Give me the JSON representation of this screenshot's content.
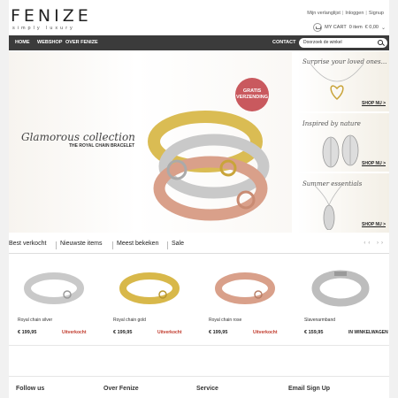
{
  "brand": {
    "name": "FENIZE",
    "tagline": "simply luxury"
  },
  "toplinks": [
    "Mijn verlanglijst",
    "Inloggen",
    "Signup"
  ],
  "cart": {
    "label": "MY CART",
    "summary": "0 item",
    "amount": "€ 0,00"
  },
  "nav": {
    "items": [
      "HOME",
      "WEBSHOP",
      "OVER FENIZE"
    ],
    "contact": "CONTACT"
  },
  "search": {
    "placeholder": "Doorzoek de winkel"
  },
  "hero": {
    "title": "Glamorous collection",
    "subtitle": "THE ROYAL CHAIN BRACELET",
    "badge_line1": "GRATIS",
    "badge_line2": "VERZENDING"
  },
  "promos": [
    {
      "title": "Surprise your loved ones...",
      "link": "SHOP NU >"
    },
    {
      "title": "Inspired by nature",
      "link": "SHOP NU >"
    },
    {
      "title": "Summer essentials",
      "link": "SHOP NU >"
    }
  ],
  "tabs": [
    "Best verkocht",
    "Nieuwste items",
    "Meest bekeken",
    "Sale"
  ],
  "tab_arrows": "‹‹ ››",
  "products": [
    {
      "name": "Royal chain silver",
      "price": "€ 199,95",
      "status": "Uitverkocht",
      "status_type": "sold",
      "color": "#c9c9c9"
    },
    {
      "name": "Royal chain gold",
      "price": "€ 199,95",
      "status": "Uitverkocht",
      "status_type": "sold",
      "color": "#d8b84a"
    },
    {
      "name": "Royal chain rose",
      "price": "€ 199,95",
      "status": "Uitverkocht",
      "status_type": "sold",
      "color": "#d9a08a"
    },
    {
      "name": "Slavenarmband",
      "price": "€ 159,95",
      "status": "IN WINKELWAGEN",
      "status_type": "cart",
      "color": "#bdbdbd"
    }
  ],
  "footer": [
    "Follow us",
    "Over Fenize",
    "Service",
    "Email Sign Up"
  ],
  "colors": {
    "nav_bg": "#3b3b3b",
    "badge": "#c9595e",
    "sold": "#c0392b"
  }
}
